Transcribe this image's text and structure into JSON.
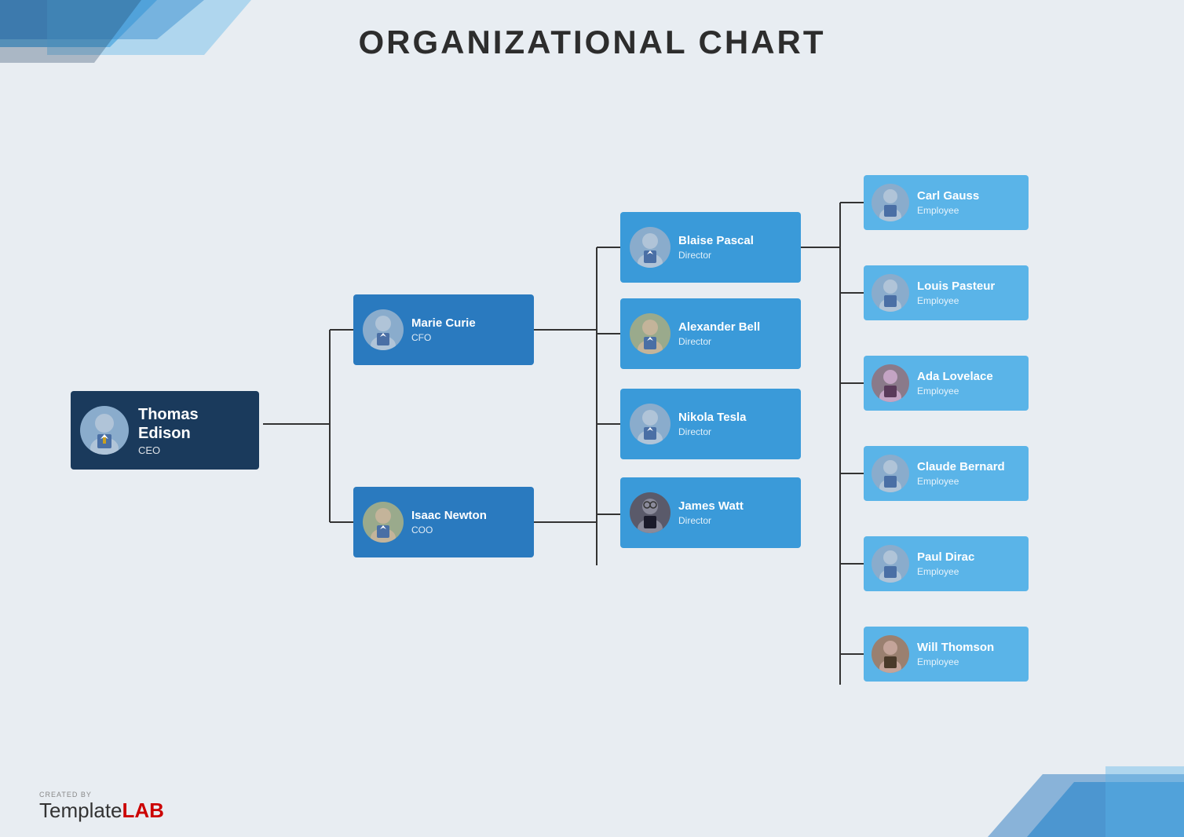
{
  "title": "ORGANIZATIONAL CHART",
  "watermark": {
    "created_by": "CREATED BY",
    "brand_regular": "Template",
    "brand_bold": "LAB"
  },
  "ceo": {
    "name": "Thomas Edison",
    "title": "CEO"
  },
  "mid_level": [
    {
      "name": "Marie Curie",
      "title": "CFO"
    },
    {
      "name": "Isaac Newton",
      "title": "COO"
    }
  ],
  "directors": [
    {
      "name": "Blaise Pascal",
      "title": "Director"
    },
    {
      "name": "Alexander Bell",
      "title": "Director"
    },
    {
      "name": "Nikola Tesla",
      "title": "Director"
    },
    {
      "name": "James Watt",
      "title": "Director"
    }
  ],
  "employees": [
    {
      "name": "Carl Gauss",
      "title": "Employee"
    },
    {
      "name": "Louis Pasteur",
      "title": "Employee"
    },
    {
      "name": "Ada Lovelace",
      "title": "Employee"
    },
    {
      "name": "Claude Bernard",
      "title": "Employee"
    },
    {
      "name": "Paul Dirac",
      "title": "Employee"
    },
    {
      "name": "Will Thomson",
      "title": "Employee"
    }
  ],
  "colors": {
    "ceo_bg": "#1a3a5c",
    "mid_bg": "#2a7abf",
    "director_bg": "#3a9ad9",
    "employee_bg": "#5ab4e8",
    "page_bg": "#e8edf2",
    "line_color": "#333333"
  }
}
